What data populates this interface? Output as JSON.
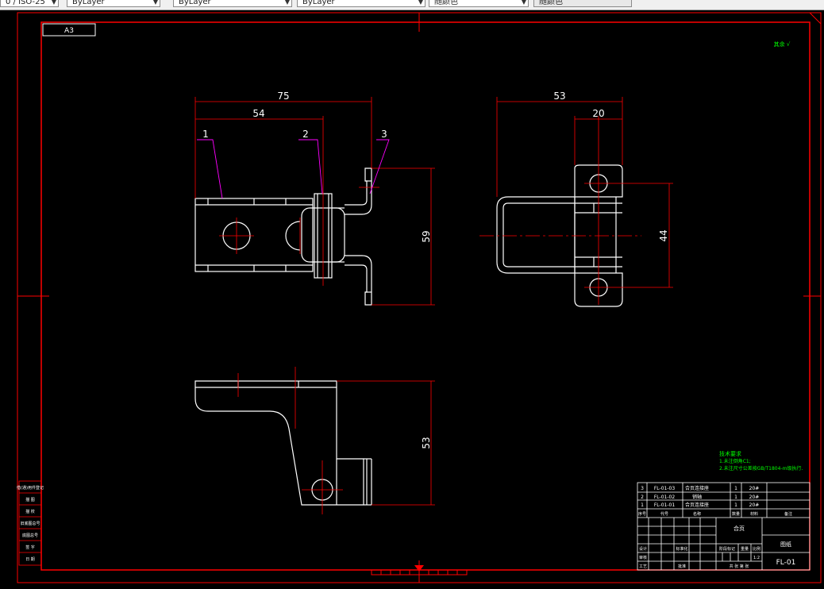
{
  "toolbar": {
    "layer_value": "0 / ISO-25",
    "color_value": "ByLayer",
    "linetype_value": "ByLayer",
    "lineweight_value": "ByLayer",
    "plotstyle_value": "随颜色"
  },
  "sheet": {
    "size_label": "A3",
    "roughness_note": "其余 √"
  },
  "dimensions": {
    "front_overall": "75",
    "front_inner": "54",
    "front_height": "59",
    "side_overall": "53",
    "side_inner": "20",
    "side_height": "44",
    "top_height": "53"
  },
  "balloons": [
    "1",
    "2",
    "3"
  ],
  "tech_requirements": {
    "title": "技术要求",
    "line1": "1.未注倒角C1;",
    "line2": "2.未注尺寸公差按GB/T1804-m级执行."
  },
  "bom": {
    "rows": [
      {
        "no": "3",
        "code": "FL-01-03",
        "name": "合页连接座",
        "qty": "1",
        "material": "20#"
      },
      {
        "no": "2",
        "code": "FL-01-02",
        "name": "销轴",
        "qty": "1",
        "material": "20#"
      },
      {
        "no": "1",
        "code": "FL-01-01",
        "name": "合页连接座",
        "qty": "1",
        "material": "20#"
      }
    ],
    "headers": [
      "序号",
      "代号",
      "名称",
      "数量",
      "材料",
      "备注"
    ]
  },
  "title_block": {
    "part_name": "合页",
    "company": "图纸",
    "drawing_no": "FL-01",
    "scale": "1:2",
    "stage_label": "阶段标记",
    "weight_label": "重量",
    "ratio_label": "比例",
    "sheet_info": "共 张 第 张",
    "designer": "设计",
    "standard": "标准化",
    "review": "审核",
    "approve": "批准",
    "craft": "工艺",
    "date": "日期"
  },
  "left_strip": [
    "借(通)用件登记",
    "描 图",
    "描 校",
    "旧底图总号",
    "底图总号",
    "签 字",
    "日 期"
  ],
  "colors": {
    "frame": "#ff0000",
    "geometry": "#ffffff",
    "dimension": "#ff0000",
    "leader": "#ff00ff",
    "note": "#00ff00"
  }
}
